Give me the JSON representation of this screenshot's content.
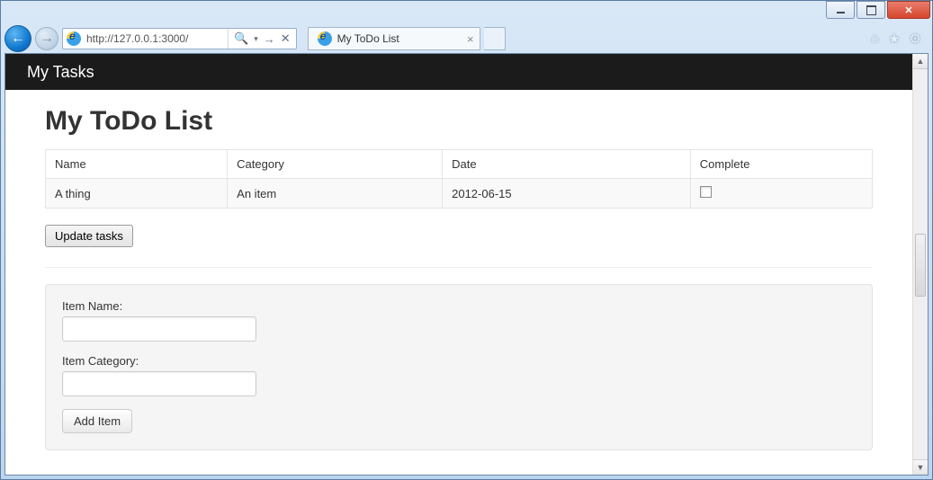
{
  "browser": {
    "url": "http://127.0.0.1:3000/",
    "tab_title": "My ToDo List"
  },
  "navbar": {
    "brand": "My Tasks"
  },
  "page": {
    "title": "My ToDo List",
    "table": {
      "headers": {
        "name": "Name",
        "category": "Category",
        "date": "Date",
        "complete": "Complete"
      },
      "rows": [
        {
          "name": "A thing",
          "category": "An item",
          "date": "2012-06-15",
          "complete": false
        }
      ]
    },
    "update_button": "Update tasks",
    "form": {
      "name_label": "Item Name:",
      "category_label": "Item Category:",
      "name_value": "",
      "category_value": "",
      "add_button": "Add Item"
    }
  }
}
